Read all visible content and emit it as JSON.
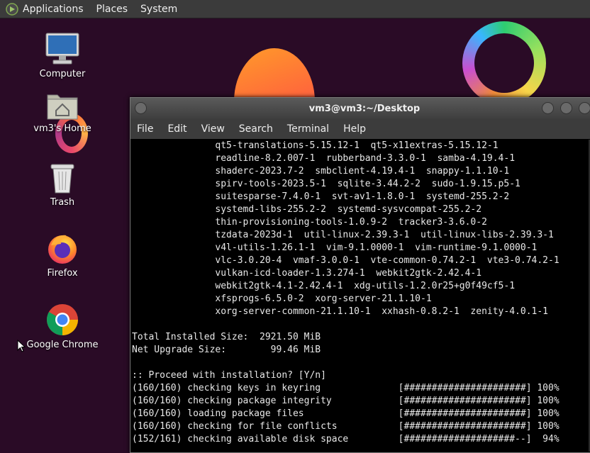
{
  "panel": {
    "menus": [
      "Applications",
      "Places",
      "System"
    ]
  },
  "desktop_icons": [
    {
      "label": "Computer",
      "icon": "computer-icon"
    },
    {
      "label": "vm3's Home",
      "icon": "home-folder-icon"
    },
    {
      "label": "Trash",
      "icon": "trash-icon"
    },
    {
      "label": "Firefox",
      "icon": "firefox-icon"
    },
    {
      "label": "Google Chrome",
      "icon": "chrome-icon"
    }
  ],
  "terminal": {
    "title": "vm3@vm3:~/Desktop",
    "menu": [
      "File",
      "Edit",
      "View",
      "Search",
      "Terminal",
      "Help"
    ],
    "lines": [
      "               qt5-translations-5.15.12-1  qt5-x11extras-5.15.12-1",
      "               readline-8.2.007-1  rubberband-3.3.0-1  samba-4.19.4-1",
      "               shaderc-2023.7-2  smbclient-4.19.4-1  snappy-1.1.10-1",
      "               spirv-tools-2023.5-1  sqlite-3.44.2-2  sudo-1.9.15.p5-1",
      "               suitesparse-7.4.0-1  svt-av1-1.8.0-1  systemd-255.2-2",
      "               systemd-libs-255.2-2  systemd-sysvcompat-255.2-2",
      "               thin-provisioning-tools-1.0.9-2  tracker3-3.6.0-2",
      "               tzdata-2023d-1  util-linux-2.39.3-1  util-linux-libs-2.39.3-1",
      "               v4l-utils-1.26.1-1  vim-9.1.0000-1  vim-runtime-9.1.0000-1",
      "               vlc-3.0.20-4  vmaf-3.0.0-1  vte-common-0.74.2-1  vte3-0.74.2-1",
      "               vulkan-icd-loader-1.3.274-1  webkit2gtk-2.42.4-1",
      "               webkit2gtk-4.1-2.42.4-1  xdg-utils-1.2.0r25+g0f49cf5-1",
      "               xfsprogs-6.5.0-2  xorg-server-21.1.10-1",
      "               xorg-server-common-21.1.10-1  xxhash-0.8.2-1  zenity-4.0.1-1",
      "",
      "Total Installed Size:  2921.50 MiB",
      "Net Upgrade Size:        99.46 MiB",
      "",
      ":: Proceed with installation? [Y/n]",
      "(160/160) checking keys in keyring              [######################] 100%",
      "(160/160) checking package integrity            [######################] 100%",
      "(160/160) loading package files                 [######################] 100%",
      "(160/160) checking for file conflicts           [######################] 100%",
      "(152/161) checking available disk space         [####################--]  94%"
    ]
  }
}
